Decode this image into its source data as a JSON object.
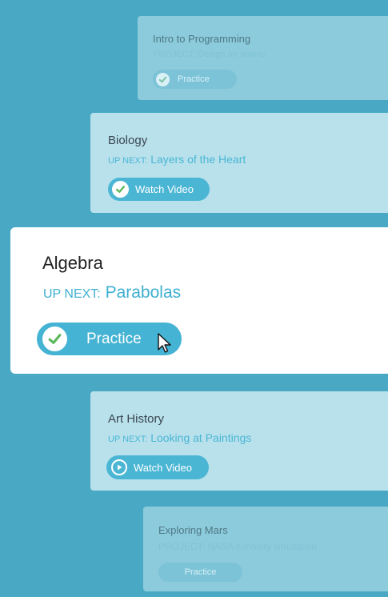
{
  "courses": [
    {
      "title": "Intro to Programming",
      "next_label": "PROJECT:",
      "next_item": "Design an animal",
      "action": "Practice",
      "icon": "check-icon"
    },
    {
      "title": "Biology",
      "next_label": "UP NEXT:",
      "next_item": "Layers of the Heart",
      "action": "Watch Video",
      "icon": "check-icon"
    },
    {
      "title": "Algebra",
      "next_label": "UP NEXT:",
      "next_item": "Parabolas",
      "action": "Practice",
      "icon": "check-icon"
    },
    {
      "title": "Art History",
      "next_label": "UP NEXT:",
      "next_item": "Looking at Paintings",
      "action": "Watch Video",
      "icon": "play-icon"
    },
    {
      "title": "Exploring Mars",
      "next_label": "PROJECT:",
      "next_item": "NASA curiosity simulation",
      "action": "Practice",
      "icon": ""
    }
  ],
  "colors": {
    "background": "#49a9c4",
    "accent": "#45b3d3",
    "check": "#5cb85c",
    "active_card": "#ffffff"
  }
}
